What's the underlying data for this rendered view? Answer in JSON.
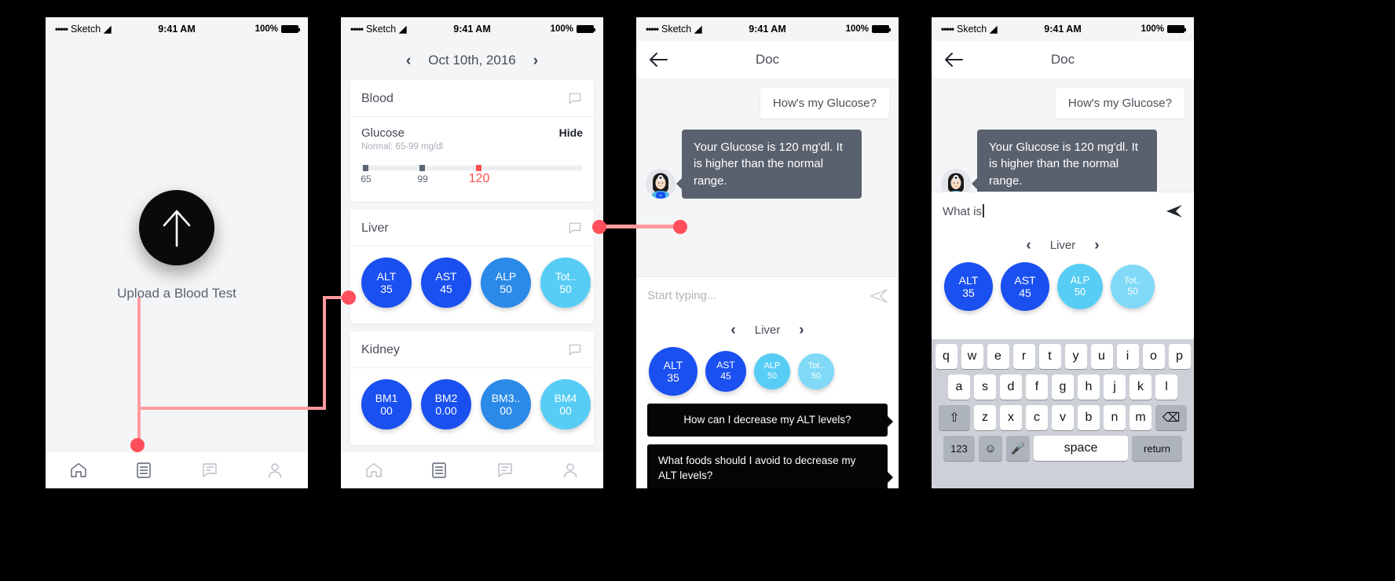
{
  "statusbar": {
    "dots": "•••••",
    "carrier": "Sketch",
    "time": "9:41 AM",
    "battery": "100%"
  },
  "screen1": {
    "upload_label": "Upload a Blood Test",
    "upload_icon": "arrow-up-icon",
    "tabs": [
      {
        "name": "home",
        "label": "Home"
      },
      {
        "name": "records",
        "label": "Records"
      },
      {
        "name": "chat",
        "label": "Chat"
      },
      {
        "name": "profile",
        "label": "Profile"
      }
    ]
  },
  "screen2": {
    "date": "Oct 10th, 2016",
    "prev": "‹",
    "next": "›",
    "cards": [
      {
        "title": "Blood",
        "metric": {
          "name": "Glucose",
          "action": "Hide",
          "normal": "Normal: 65-99 mg/dl",
          "low": "65",
          "high": "99",
          "value": "120"
        }
      },
      {
        "title": "Liver",
        "circles": [
          {
            "label": "ALT",
            "value": "35",
            "color": "#1a4ff0"
          },
          {
            "label": "AST",
            "value": "45",
            "color": "#1a4ff0"
          },
          {
            "label": "ALP",
            "value": "50",
            "color": "#2b8ae8"
          },
          {
            "label": "Tot..",
            "value": "50",
            "color": "#57cdf5"
          }
        ]
      },
      {
        "title": "Kidney",
        "circles": [
          {
            "label": "BM1",
            "value": "00",
            "color": "#1a4ff0"
          },
          {
            "label": "BM2",
            "value": "0.00",
            "color": "#1a4ff0"
          },
          {
            "label": "BM3..",
            "value": "00",
            "color": "#2b8ae8"
          },
          {
            "label": "BM4",
            "value": "00",
            "color": "#57cdf5"
          }
        ]
      }
    ]
  },
  "screen3": {
    "nav_title": "Doc",
    "back_icon": "arrow-left-icon",
    "messages": [
      {
        "from": "user",
        "text": "How's my Glucose?"
      },
      {
        "from": "doc",
        "text": "Your Glucose is 120 mg'dl. It is higher than the normal range."
      }
    ],
    "composer_placeholder": "Start typing...",
    "send_icon": "send-icon",
    "panel": {
      "prev": "‹",
      "title": "Liver",
      "next": "›",
      "circles": [
        {
          "label": "ALT",
          "value": "35",
          "color": "#1a4ff0"
        },
        {
          "label": "AST",
          "value": "45",
          "color": "#1a4ff0"
        },
        {
          "label": "ALP",
          "value": "50",
          "color": "#57cdf5"
        },
        {
          "label": "Tot..",
          "value": "50",
          "color": "#57cdf5"
        }
      ]
    },
    "suggestions": [
      "How can I decrease my ALT levels?",
      "What foods should I avoid to decrease my ALT levels?"
    ]
  },
  "screen4": {
    "nav_title": "Doc",
    "back_icon": "arrow-left-icon",
    "messages": [
      {
        "from": "user",
        "text": "How's my Glucose?"
      },
      {
        "from": "doc",
        "text": "Your Glucose is 120 mg'dl. It is higher than the normal range."
      }
    ],
    "composer_value": "What is",
    "send_icon": "send-icon",
    "panel": {
      "prev": "‹",
      "title": "Liver",
      "next": "›",
      "circles": [
        {
          "label": "ALT",
          "value": "35",
          "color": "#1a4ff0"
        },
        {
          "label": "AST",
          "value": "45",
          "color": "#1a4ff0"
        },
        {
          "label": "ALP",
          "value": "50",
          "color": "#57cdf5"
        },
        {
          "label": "Tot..",
          "value": "50",
          "color": "#57cdf5"
        }
      ]
    },
    "keyboard": {
      "row1": [
        "q",
        "w",
        "e",
        "r",
        "t",
        "y",
        "u",
        "i",
        "o",
        "p"
      ],
      "row2": [
        "a",
        "s",
        "d",
        "f",
        "g",
        "h",
        "j",
        "k",
        "l"
      ],
      "row3": [
        "z",
        "x",
        "c",
        "v",
        "b",
        "n",
        "m"
      ],
      "shift": "⇧",
      "backspace": "⌫",
      "numbers": "123",
      "emoji": "☺",
      "mic": "🎤",
      "space": "space",
      "return": "return"
    }
  },
  "colors": {
    "accent_red": "#ff4f5a",
    "connector": "#ff9a9f",
    "blue_dark": "#1a4ff0",
    "blue_mid": "#2b8ae8",
    "blue_light": "#57cdf5",
    "bubble_doc": "#5a616e"
  }
}
